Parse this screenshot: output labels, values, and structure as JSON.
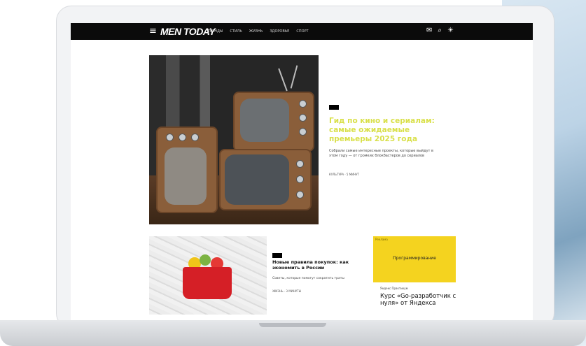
{
  "header": {
    "logo": "MEN TODAY",
    "menu_icon": "hamburger-icon",
    "nav": [
      "ТРЕНДЫ",
      "СТИЛЬ",
      "ЖИЗНЬ",
      "ЗДОРОВЬЕ",
      "СПОРТ"
    ],
    "tools": [
      {
        "icon": "mail-icon",
        "glyph": "✉"
      },
      {
        "icon": "search-icon",
        "glyph": "⌕"
      },
      {
        "icon": "sun-icon",
        "glyph": "☀"
      }
    ]
  },
  "hero": {
    "badge": "",
    "title": "Гид по кино и сериалам: самые ожидаемые премьеры 2025 года",
    "description": "Собрали самые интересные проекты, которые выйдут в этом году — от громких блокбастеров до сериалов",
    "meta": "КУЛЬТУРА · 5 МИНУТ"
  },
  "card": {
    "title": "Новые правила покупок: как экономить в России",
    "description": "Советы, которые помогут сократить траты",
    "meta": "ЖИЗНЬ · 3 МИНУТЫ"
  },
  "promo": {
    "ad_tag": "Реклама",
    "ad_text": "Программирование",
    "meta": "Яндекс Практикум",
    "title": "Курс «Go-разработчик с нуля» от Яндекса"
  },
  "colors": {
    "accent_yellow": "#f4d31f",
    "hero_title_color": "#d9e04a",
    "header_bg": "#0b0b0b"
  }
}
